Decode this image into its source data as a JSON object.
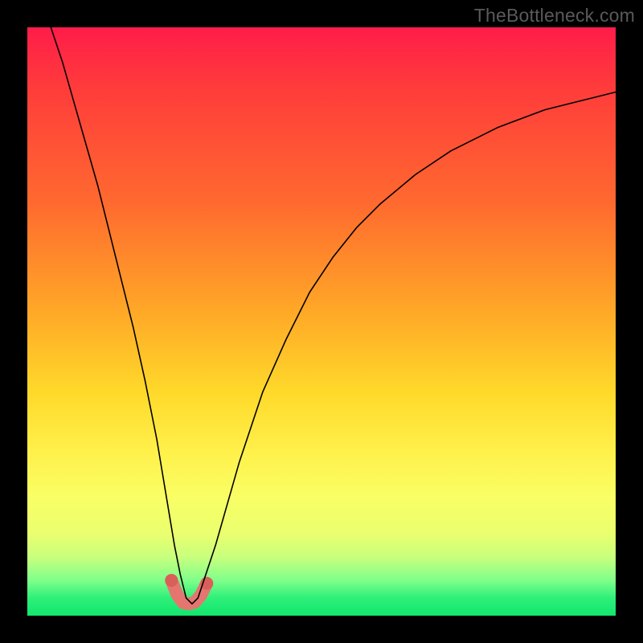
{
  "watermark": "TheBottleneck.com",
  "chart_data": {
    "type": "line",
    "title": "",
    "xlabel": "",
    "ylabel": "",
    "xlim": [
      0,
      100
    ],
    "ylim": [
      0,
      100
    ],
    "grid": false,
    "legend": false,
    "notes": "V-shaped bottleneck curve with minimum near x≈27; salmon marker highlights the trough on a red-to-green gradient background.",
    "series": [
      {
        "name": "curve",
        "x": [
          4,
          6,
          8,
          10,
          12,
          14,
          16,
          18,
          20,
          22,
          24,
          25,
          26,
          27,
          28,
          29,
          30,
          32,
          34,
          36,
          38,
          40,
          44,
          48,
          52,
          56,
          60,
          66,
          72,
          80,
          88,
          96,
          100
        ],
        "y": [
          100,
          94,
          87,
          80,
          73,
          65,
          57,
          49,
          40,
          30,
          18,
          12,
          7,
          3,
          2,
          3,
          6,
          12,
          19,
          26,
          32,
          38,
          47,
          55,
          61,
          66,
          70,
          75,
          79,
          83,
          86,
          88,
          89
        ]
      },
      {
        "name": "trough-marker",
        "x": [
          24.5,
          25.5,
          26.5,
          27.5,
          28.5,
          29.5,
          30.5
        ],
        "y": [
          6.0,
          3.5,
          2.2,
          2.0,
          2.3,
          3.5,
          5.5
        ]
      }
    ]
  }
}
